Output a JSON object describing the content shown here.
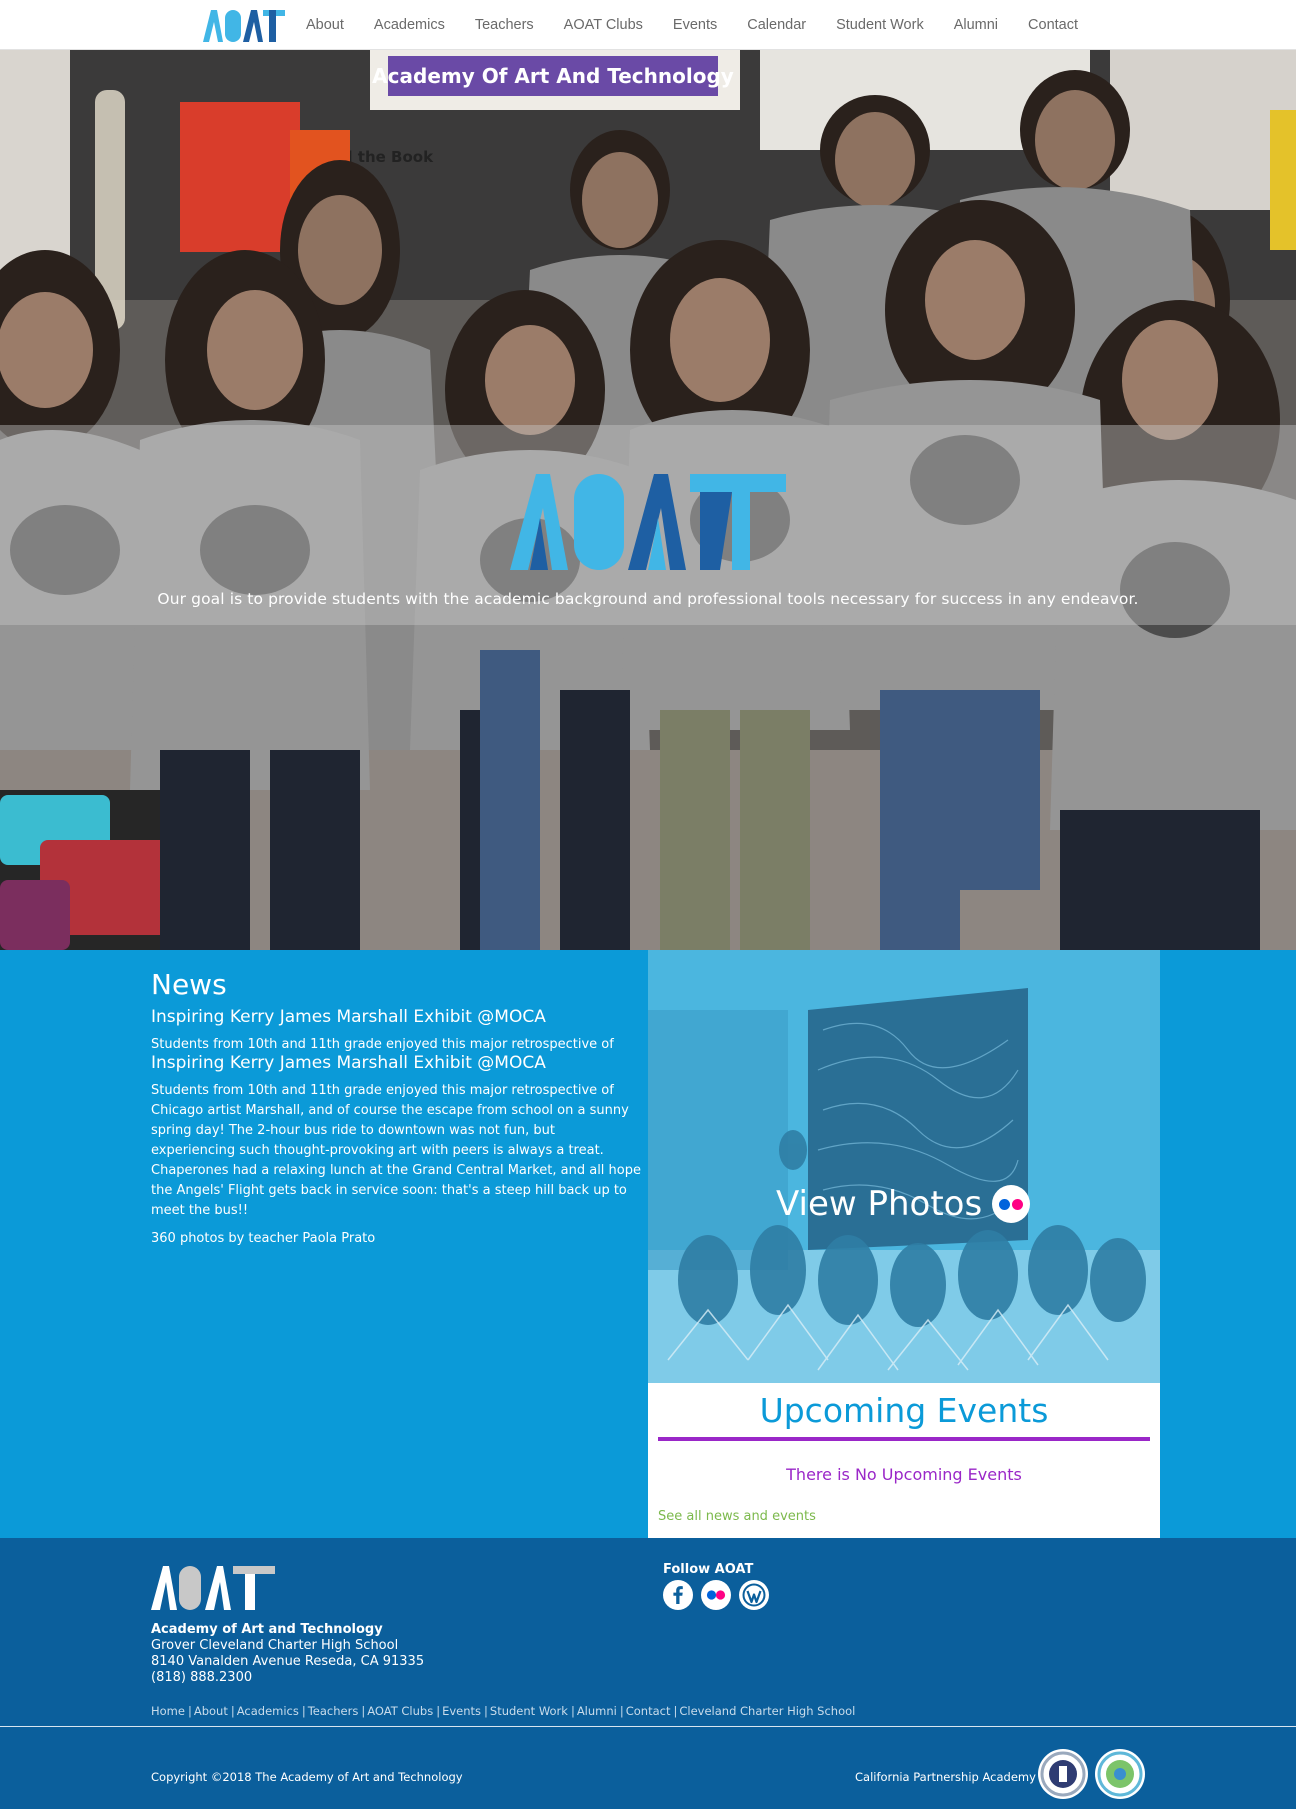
{
  "header": {
    "logo_text": "AOAT",
    "nav": [
      "About",
      "Academics",
      "Teachers",
      "AOAT Clubs",
      "Events",
      "Calendar",
      "Student Work",
      "Alumni",
      "Contact"
    ]
  },
  "hero": {
    "logo_text": "AOAT",
    "banner_text": "Academy Of Art And Technology",
    "poster_text": "Read the Book",
    "tagline": "Our goal is to provide students with the academic background and professional tools necessary for success in any endeavor."
  },
  "news": {
    "heading": "News",
    "article_title": "Inspiring Kerry James Marshall Exhibit @MOCA",
    "excerpt": "Students from 10th and 11th grade enjoyed this major retrospective of",
    "article_title_repeat": "Inspiring Kerry James Marshall Exhibit @MOCA",
    "body": "Students from 10th and 11th grade enjoyed this major retrospective of Chicago artist Marshall, and of course the escape from school on a sunny spring day! The 2-hour bus ride to downtown was not fun, but experiencing such thought-provoking art with peers is always a treat. Chaperones had a relaxing lunch at the Grand Central Market, and all hope the Angels' Flight gets back in service soon: that's a steep hill back up to meet the bus!!",
    "credit": "360 photos by teacher Paola Prato"
  },
  "photos": {
    "label": "View Photos",
    "icon": "flickr-icon"
  },
  "events": {
    "heading": "Upcoming Events",
    "empty_message": "There is No Upcoming Events",
    "see_all": "See all news and events"
  },
  "footer": {
    "logo_text": "AOAT",
    "org_name": "Academy of Art and Technology",
    "school": "Grover Cleveland Charter High School",
    "address": "8140 Vanalden Avenue Reseda, CA 91335",
    "phone": "(818) 888.2300",
    "follow": "Follow AOAT",
    "social_icons": [
      "facebook-icon",
      "flickr-icon",
      "wordpress-icon"
    ],
    "links": [
      "Home",
      "About",
      "Academics",
      "Teachers",
      "AOAT Clubs",
      "Events",
      "Student Work",
      "Alumni",
      "Contact",
      "Cleveland Charter High School"
    ],
    "copyright": "Copyright ©2018 The Academy of Art and Technology",
    "partnership": "California Partnership Academy"
  },
  "colors": {
    "brand_blue": "#0b9ad8",
    "footer_blue": "#0b5f9c",
    "events_purple": "#9a27c8",
    "link_green": "#7cb94c",
    "logo_light": "#41b6e6",
    "logo_dark": "#1e5fa3"
  }
}
